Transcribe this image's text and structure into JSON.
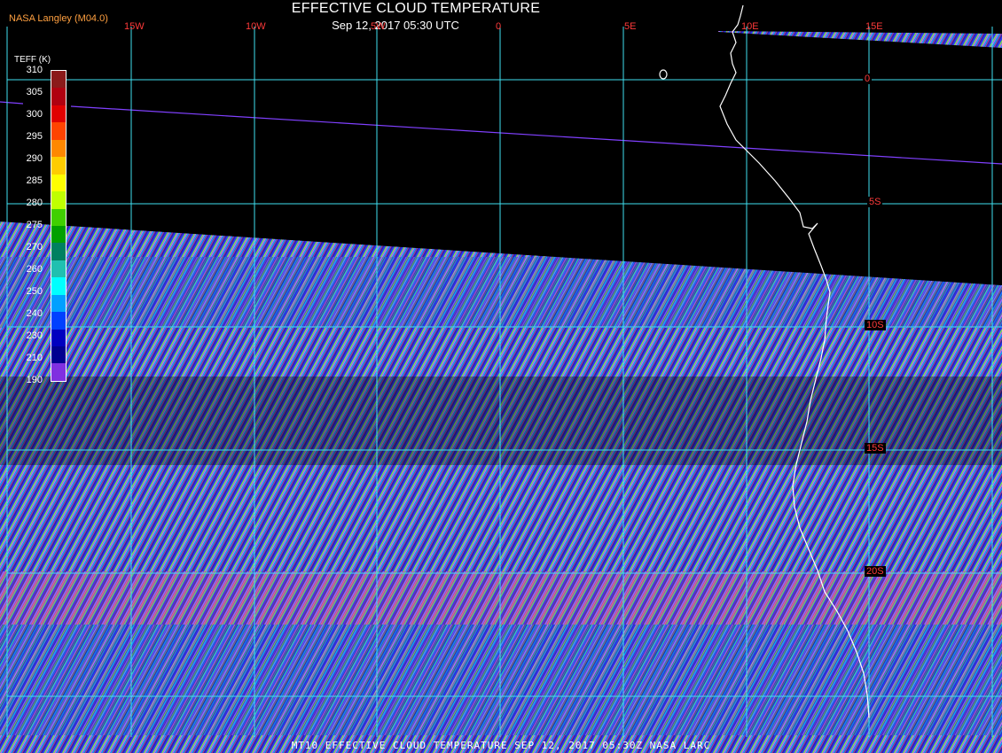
{
  "header": {
    "org_label": "NASA Langley (M04.0)",
    "title": "EFFECTIVE CLOUD TEMPERATURE",
    "subtitle": "Sep 12, 2017 05:30 UTC"
  },
  "grid": {
    "longitude_labels": [
      "15W",
      "10W",
      "5W",
      "0",
      "5E",
      "10E",
      "15E"
    ],
    "latitude_labels": [
      "0",
      "5S",
      "10S",
      "15S",
      "20S"
    ],
    "grid_color": "#40e0f0",
    "label_color": "#ff3a3a"
  },
  "colorbar": {
    "title": "TEFF (K)",
    "tick_labels": [
      "310",
      "305",
      "300",
      "295",
      "290",
      "285",
      "280",
      "275",
      "270",
      "260",
      "250",
      "240",
      "230",
      "210",
      "190"
    ],
    "segment_colors": [
      "#8b1a1a",
      "#b00010",
      "#e00000",
      "#ff4400",
      "#ff8800",
      "#ffcc00",
      "#ffff00",
      "#c0ff00",
      "#40d000",
      "#00a000",
      "#008060",
      "#20c0b0",
      "#00ffff",
      "#00a0ff",
      "#0040ff",
      "#0000c0",
      "#000090",
      "#8030e0"
    ]
  },
  "map": {
    "coastline_color": "#ffffff",
    "track_color": "#8040ff",
    "swath_colors": [
      "#3030ff",
      "#00b8ff",
      "#80ff40",
      "#c070ff",
      "#ff40a0",
      "#2020a0"
    ]
  },
  "footer": {
    "caption": "MT10  EFFECTIVE CLOUD TEMPERATURE   SEP 12, 2017 05:30Z   NASA LARC"
  }
}
